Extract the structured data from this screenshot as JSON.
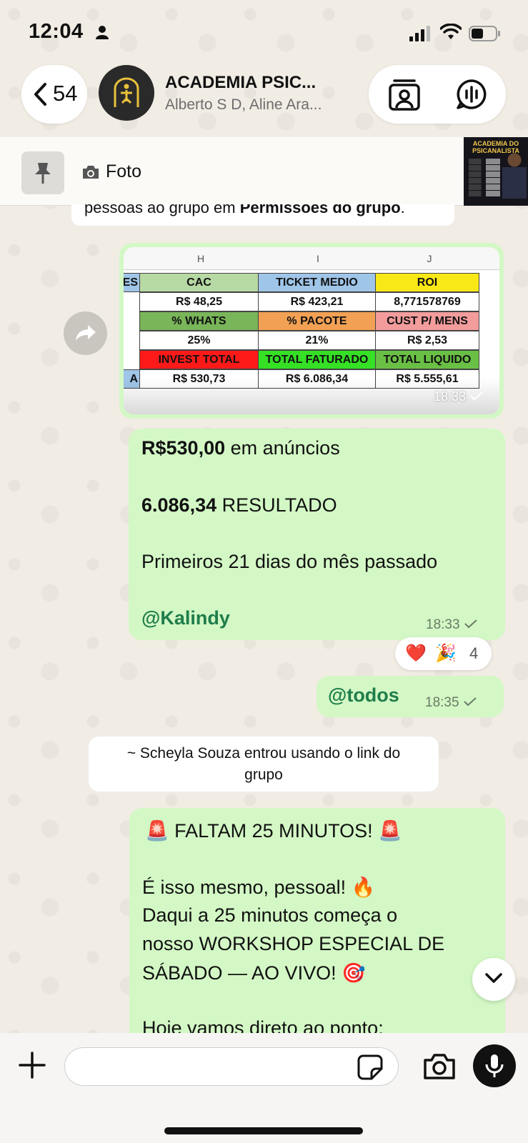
{
  "status_bar": {
    "time": "12:04"
  },
  "header": {
    "back_count": "54",
    "title": "ACADEMIA PSIC...",
    "members": "Alberto S D, Aline Ara..."
  },
  "pinned": {
    "label": "Foto",
    "thumb_title": "ACADEMIA DO PSICANALISTA"
  },
  "system_top": {
    "text_before": "pessoas ao grupo em ",
    "text_bold": "Permissões do grupo",
    "text_after": "."
  },
  "spreadsheet": {
    "columns": [
      "H",
      "I",
      "J"
    ],
    "left_fragments": [
      "ES",
      "A"
    ],
    "rows": [
      [
        {
          "text": "CAC",
          "bg": "#b7d9a4"
        },
        {
          "text": "TICKET MEDIO",
          "bg": "#9fc5e8"
        },
        {
          "text": "ROI",
          "bg": "#f9e817"
        }
      ],
      [
        {
          "text": "R$ 48,25",
          "bg": "#ffffff"
        },
        {
          "text": "R$ 423,21",
          "bg": "#ffffff"
        },
        {
          "text": "8,771578769",
          "bg": "#ffffff"
        }
      ],
      [
        {
          "text": "% WHATS",
          "bg": "#79b559"
        },
        {
          "text": "% PACOTE",
          "bg": "#f2a154"
        },
        {
          "text": "CUST P/ MENS",
          "bg": "#f39c9c"
        }
      ],
      [
        {
          "text": "25%",
          "bg": "#ffffff"
        },
        {
          "text": "21%",
          "bg": "#ffffff"
        },
        {
          "text": "R$ 2,53",
          "bg": "#ffffff"
        }
      ],
      [
        {
          "text": "INVEST TOTAL",
          "bg": "#ff1a1a"
        },
        {
          "text": "TOTAL FATURADO",
          "bg": "#35e025"
        },
        {
          "text": "TOTAL LIQUIDO",
          "bg": "#6abf45"
        }
      ],
      [
        {
          "text": "R$ 530,73",
          "bg": "#ffffff"
        },
        {
          "text": "R$ 6.086,34",
          "bg": "#ffffff"
        },
        {
          "text": "R$ 5.555,61",
          "bg": "#ffffff"
        }
      ]
    ],
    "time": "18:33"
  },
  "message_results": {
    "line1_bold": "R$530,00",
    "line1_rest": " em anúncios",
    "line2_bold": "6.086,34",
    "line2_rest": " RESULTADO",
    "line3": "Primeiros 21 dias do mês passado",
    "mention": "@Kalindy",
    "time": "18:33"
  },
  "reactions": {
    "emoji1": "❤️",
    "emoji2": "🎉",
    "count": "4"
  },
  "message_todos": {
    "mention": "@todos",
    "time": "18:35"
  },
  "system_join": {
    "text": "~ Scheyla Souza entrou usando o link do grupo"
  },
  "message_workshop": {
    "line1": "🚨 FALTAM 25 MINUTOS! 🚨",
    "line2": "É isso mesmo, pessoal! 🔥",
    "line3": "Daqui a 25 minutos começa o",
    "line4": "nosso WORKSHOP ESPECIAL DE",
    "line5": "SÁBADO — AO VIVO! 🎯",
    "line6": "Hoje vamos direto ao ponto:"
  },
  "composer": {
    "placeholder": ""
  },
  "colors": {
    "bubble_out": "#d3f8c5",
    "mention": "#1f7d4b",
    "wallpaper": "#f1ece4"
  }
}
